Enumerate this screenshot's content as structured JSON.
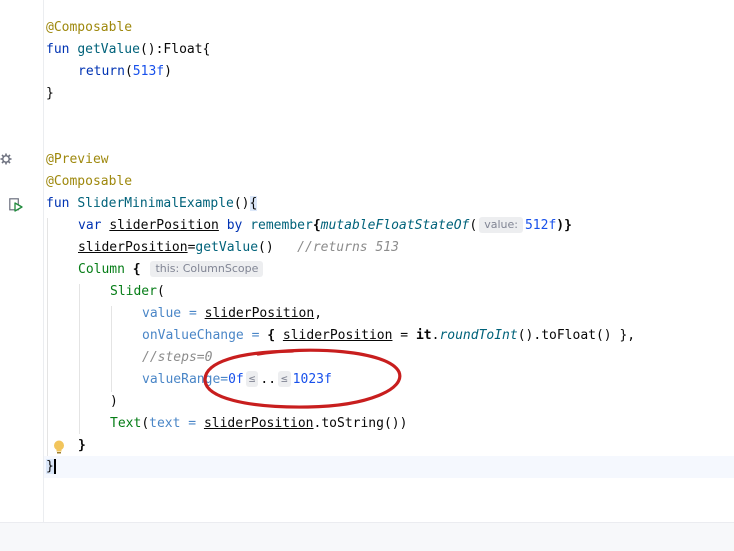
{
  "code": {
    "l1_ann": "@Composable",
    "l2_kw": "fun",
    "l2_fn": "getValue",
    "l2_rest": "():Float{",
    "l3_kw": "return",
    "l3_open": "(",
    "l3_num": "513f",
    "l3_close": ")",
    "l4": "}",
    "l5_ann": "@Preview",
    "l6_ann": "@Composable",
    "l7_kw": "fun",
    "l7_fn": "SliderMinimalExample",
    "l7_paren": "()",
    "l7_brace": "{",
    "l8_kw": "var",
    "l8_var": "sliderPosition",
    "l8_by": "by",
    "l8_remember": "remember",
    "l8_brace": "{",
    "l8_fn": "mutableFloatStateOf",
    "l8_open": "(",
    "l8_hint": "value:",
    "l8_num": "512f",
    "l8_close": ")}",
    "l9_var": "sliderPosition",
    "l9_eq": "=",
    "l9_fn": "getValue",
    "l9_paren": "()",
    "l9_comment": "//returns 513",
    "l10_col": "Column",
    "l10_brace": "{",
    "l10_hint": "this: ColumnScope",
    "l11_slider": "Slider",
    "l11_open": "(",
    "l12_param": "value",
    "l12_eq": " = ",
    "l12_var": "sliderPosition",
    "l12_comma": ",",
    "l13_param": "onValueChange",
    "l13_eq": " = ",
    "l13_open": "{ ",
    "l13_var": "sliderPosition",
    "l13_eq2": " = ",
    "l13_it": "it",
    "l13_dot": ".",
    "l13_fn": "roundToInt",
    "l13_rest": "().toFloat() },",
    "l14_comment": "//steps=0",
    "l15_param": "valueRange",
    "l15_eq": "=",
    "l15_num1": "0f",
    "l15_le1": "≤",
    "l15_dots": "..",
    "l15_le2": "≤",
    "l15_num2": "1023f",
    "l16": ")",
    "l17_text": "Text",
    "l17_open": "(",
    "l17_param": "text",
    "l17_eq": " = ",
    "l17_var": "sliderPosition",
    "l17_rest": ".toString())",
    "l18": "}",
    "l19": "}"
  },
  "icons": {
    "settings": "gear-icon",
    "run": "run-preview-icon",
    "intention": "lightbulb-icon"
  },
  "colors": {
    "annotation": "#9e880d",
    "keyword": "#0033b3",
    "function": "#00627a",
    "number": "#1750eb",
    "comment": "#8c8c8c",
    "parameter": "#4a86c7",
    "composable": "#067d17",
    "highlight_circle": "#c81e1e"
  }
}
